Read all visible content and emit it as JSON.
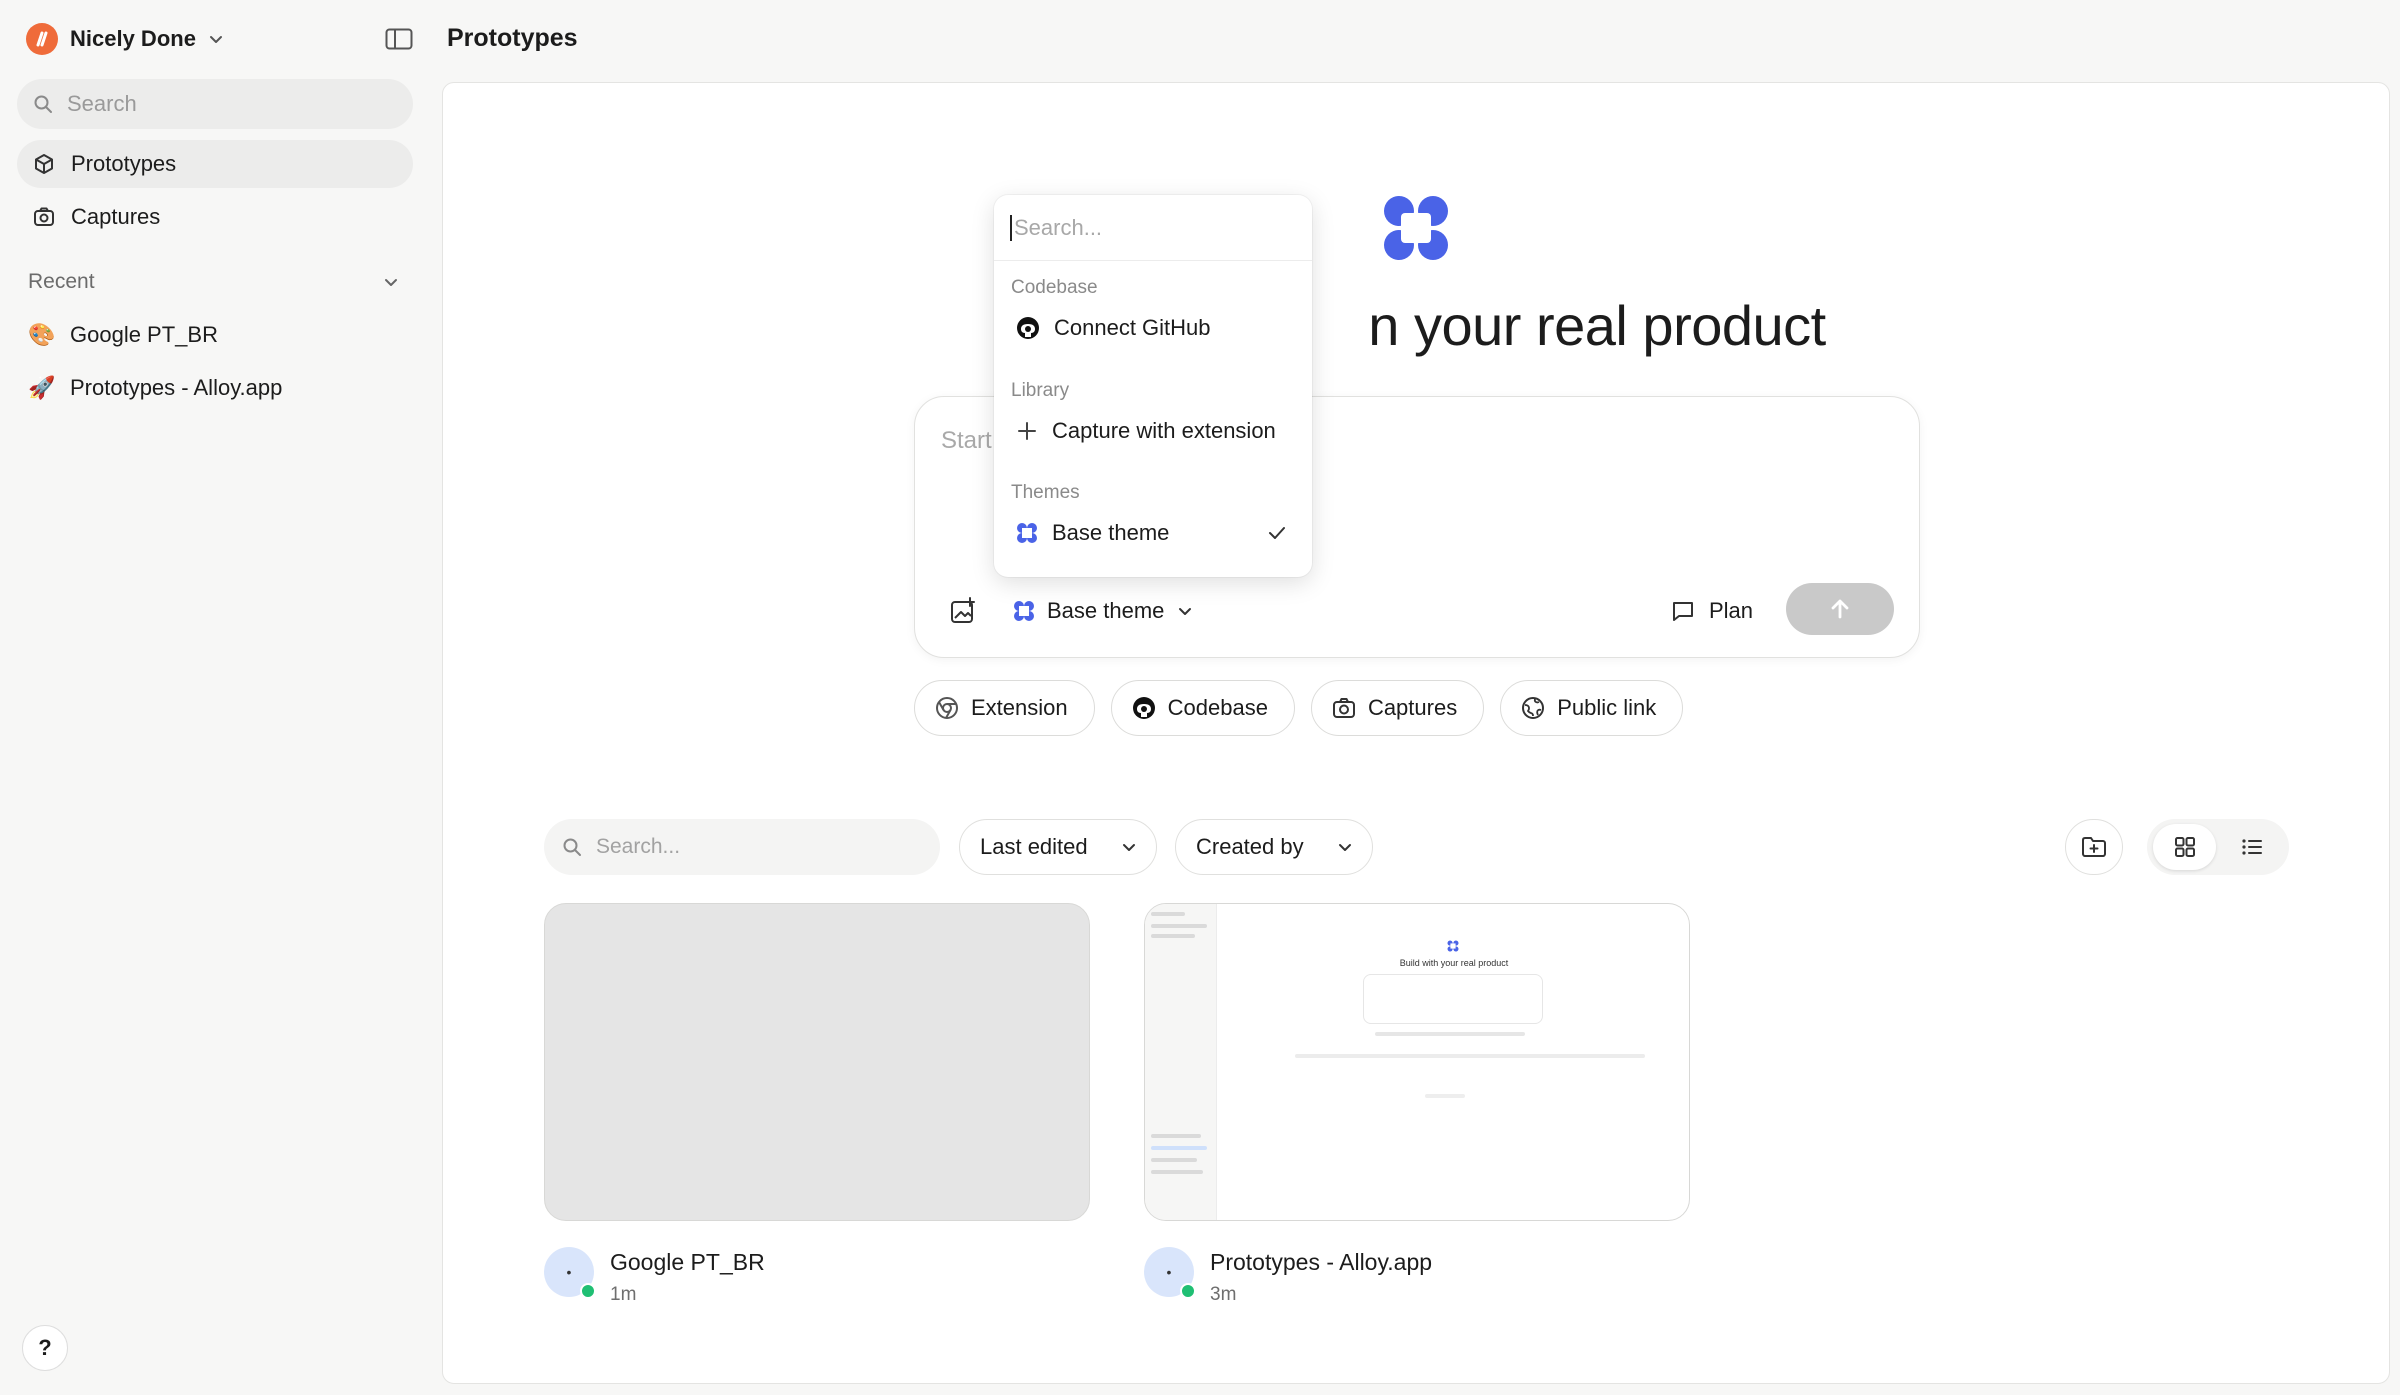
{
  "workspace": {
    "name": "Nicely Done"
  },
  "sidebar": {
    "search_placeholder": "Search",
    "nav": [
      {
        "label": "Prototypes",
        "icon": "cube-icon",
        "active": true
      },
      {
        "label": "Captures",
        "icon": "camera-icon",
        "active": false
      }
    ],
    "recent_label": "Recent",
    "recent": [
      {
        "label": "Google PT_BR",
        "emoji": "🎨"
      },
      {
        "label": "Prototypes - Alloy.app",
        "emoji": "🚀"
      }
    ],
    "help_label": "?"
  },
  "header": {
    "title": "Prototypes"
  },
  "hero": {
    "title_visible": "n your real product"
  },
  "composer": {
    "placeholder": "Start",
    "theme_label": "Base theme",
    "plan_label": "Plan"
  },
  "chips": [
    {
      "label": "Extension",
      "icon": "chrome-icon"
    },
    {
      "label": "Codebase",
      "icon": "github-icon"
    },
    {
      "label": "Captures",
      "icon": "camera-icon"
    },
    {
      "label": "Public link",
      "icon": "globe-icon"
    }
  ],
  "toolbar": {
    "search_placeholder": "Search...",
    "sort_label": "Last edited",
    "created_by_label": "Created by"
  },
  "projects": [
    {
      "title": "Google PT_BR",
      "time": "1m",
      "avatar": "•"
    },
    {
      "title": "Prototypes - Alloy.app",
      "time": "3m",
      "avatar": "•"
    }
  ],
  "thumb_preview": {
    "title": "Build with your real product"
  },
  "popover": {
    "search_placeholder": "Search...",
    "sections": [
      {
        "label": "Codebase",
        "item": "Connect GitHub"
      },
      {
        "label": "Library",
        "item": "Capture with extension"
      },
      {
        "label": "Themes",
        "item": "Base theme",
        "selected": true
      }
    ]
  },
  "colors": {
    "brand_blue": "#4a63e7",
    "workspace_orange": "#ef6b3a",
    "online_green": "#1fbf73",
    "send_disabled": "#c9c9c9"
  }
}
